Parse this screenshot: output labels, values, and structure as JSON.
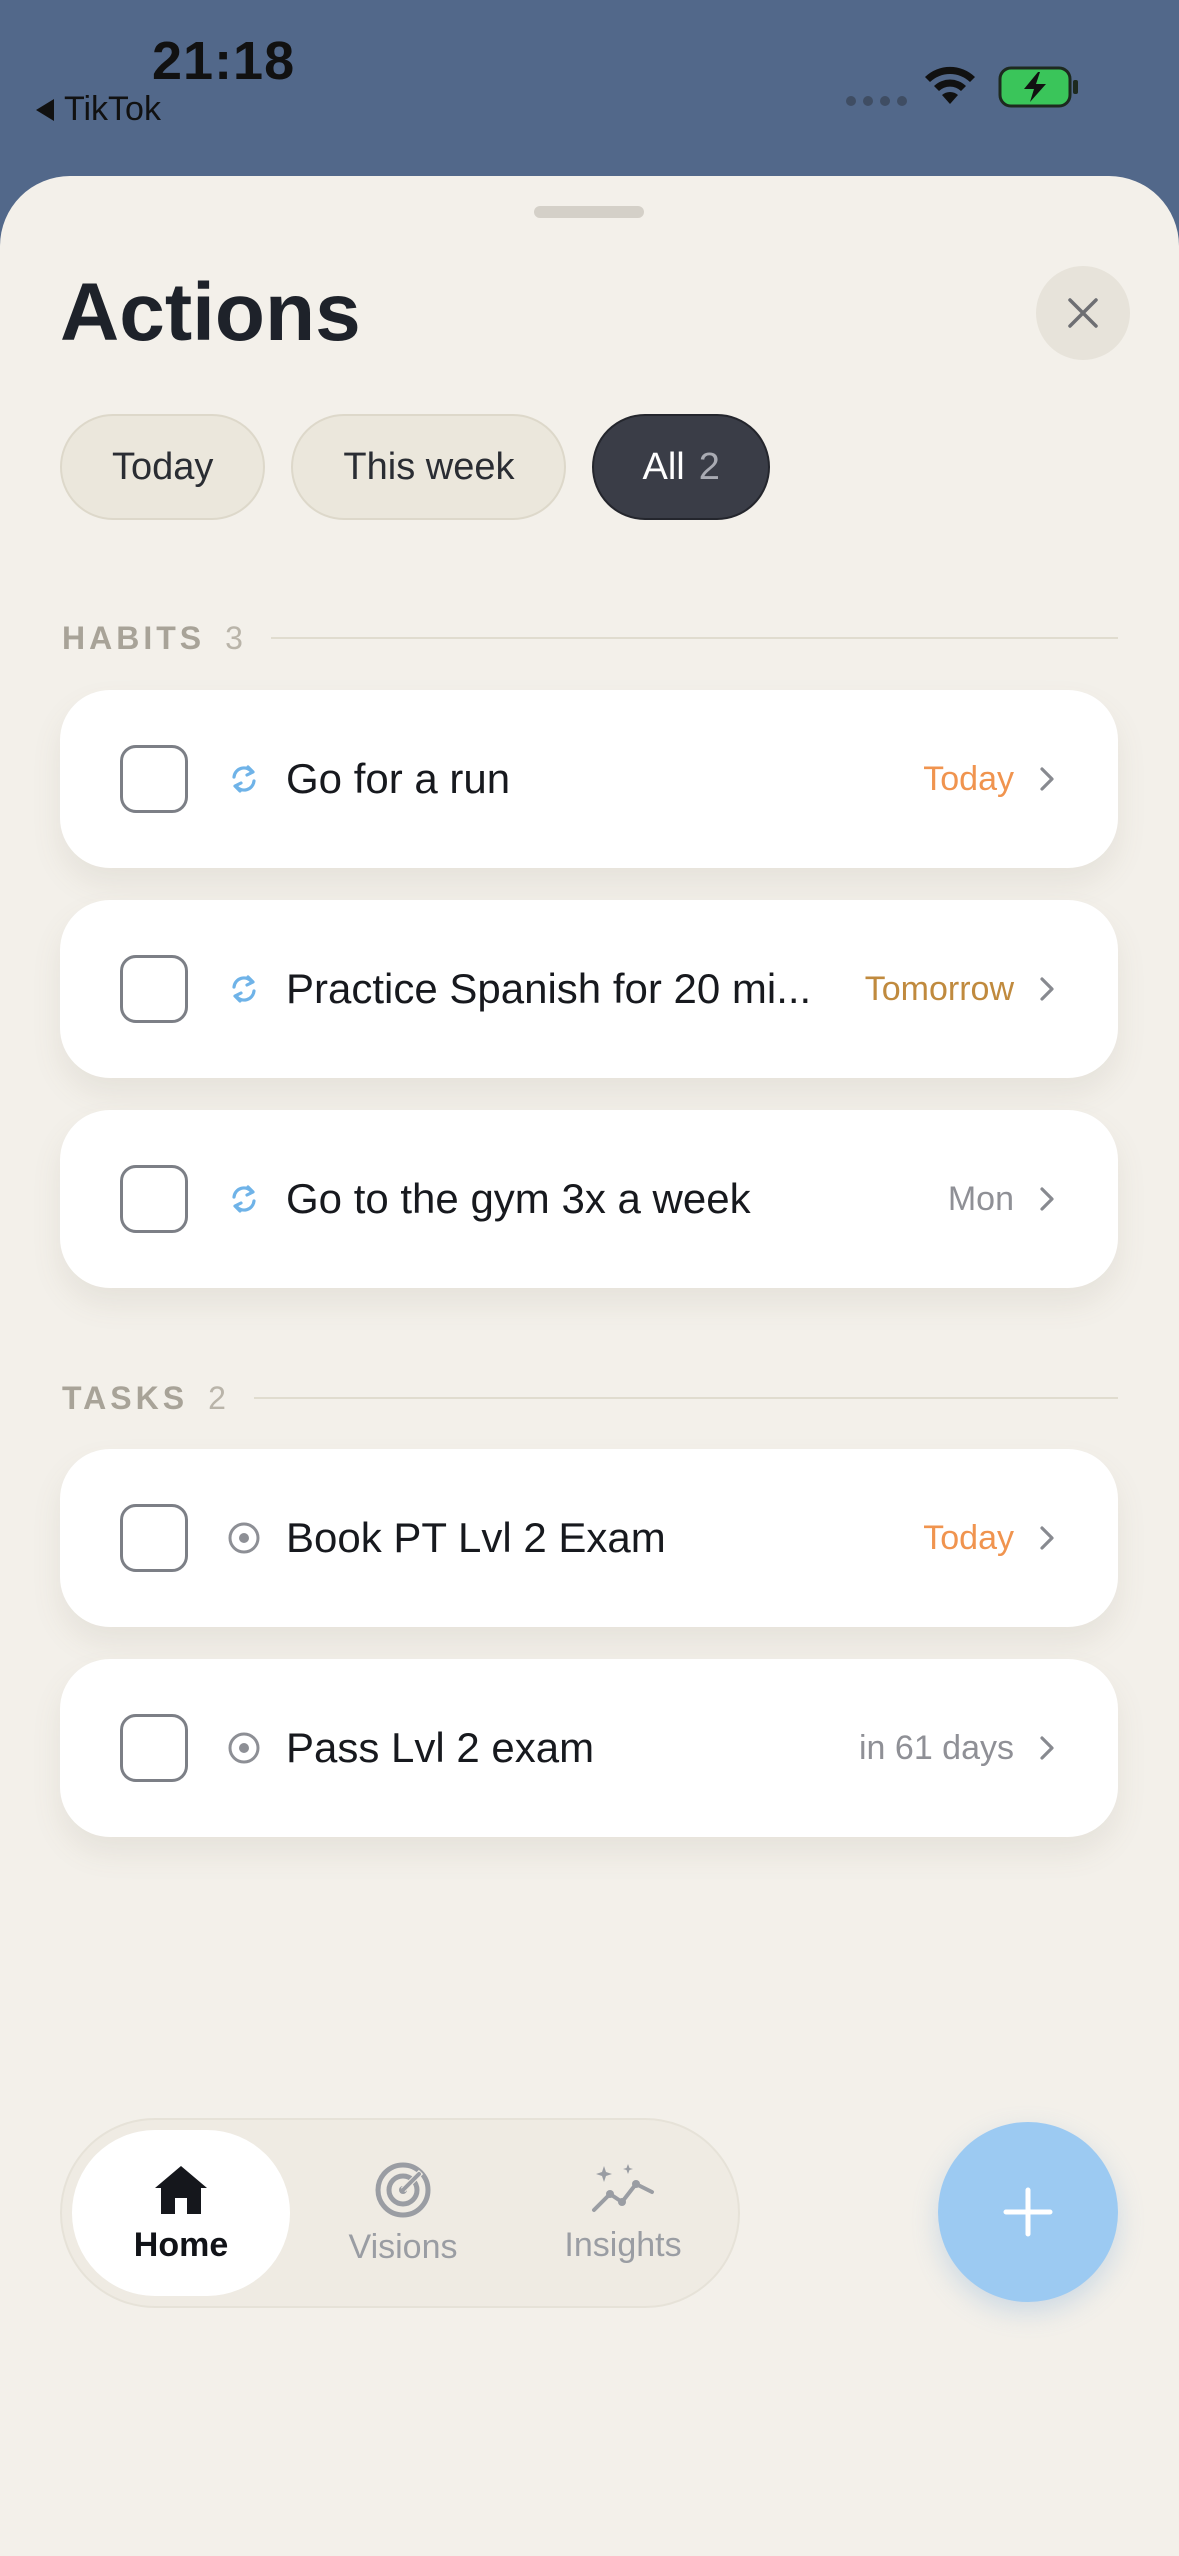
{
  "status_bar": {
    "time": "21:18",
    "back_app": "TikTok"
  },
  "sheet": {
    "title": "Actions",
    "filters": [
      {
        "label": "Today"
      },
      {
        "label": "This week"
      },
      {
        "label": "All",
        "count": "2",
        "selected": true
      }
    ]
  },
  "habits": {
    "label": "HABITS",
    "count": "3",
    "items": [
      {
        "name": "Go for a run",
        "due": "Today",
        "due_color": "#f0944f",
        "icon": "repeat-icon"
      },
      {
        "name": "Practice Spanish for 20 mi...",
        "due": "Tomorrow",
        "due_color": "#c08a3e",
        "icon": "repeat-icon"
      },
      {
        "name": "Go to the gym 3x a week",
        "due": "Mon",
        "due_color": "#8f9096",
        "icon": "repeat-icon"
      }
    ]
  },
  "tasks": {
    "label": "TASKS",
    "count": "2",
    "items": [
      {
        "name": "Book PT Lvl 2 Exam",
        "due": "Today",
        "due_color": "#f0944f",
        "icon": "target-dot-icon"
      },
      {
        "name": "Pass Lvl 2 exam",
        "due": "in 61 days",
        "due_color": "#8f9096",
        "icon": "target-dot-icon"
      }
    ]
  },
  "nav": {
    "tabs": [
      {
        "label": "Home",
        "icon": "home-icon",
        "active": true
      },
      {
        "label": "Visions",
        "icon": "radar-icon"
      },
      {
        "label": "Insights",
        "icon": "sparkle-chart-icon"
      }
    ]
  },
  "colors": {
    "accent": "#9ccaf2",
    "background": "#f3f0ea",
    "header": "#52688a"
  }
}
